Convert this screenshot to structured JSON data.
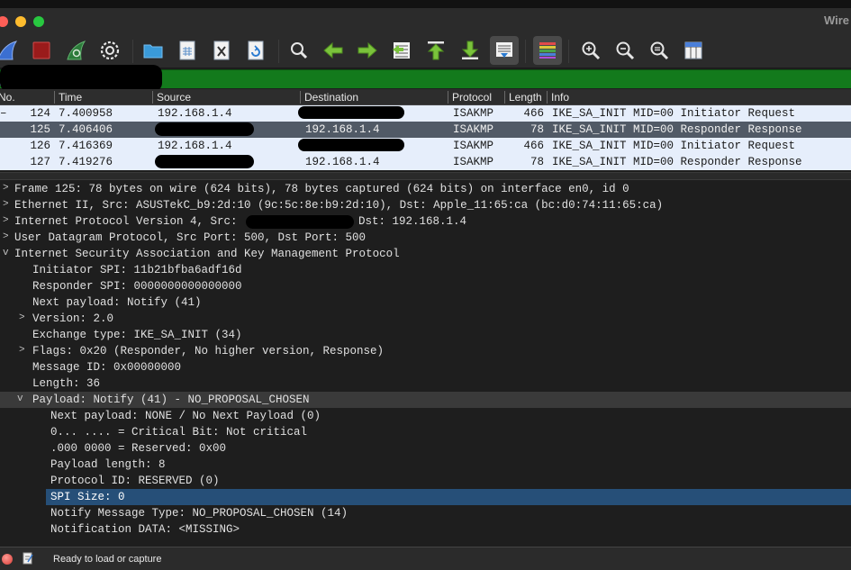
{
  "window": {
    "title": "Wire"
  },
  "colors": {
    "accent_green": "#137a1c",
    "selected_row": "#515a66",
    "selected_field": "#264f78"
  },
  "toolbar": {
    "icons": [
      "shark-fin-start-icon",
      "stop-icon",
      "restart-icon",
      "gear-options-icon",
      "folder-open-icon",
      "file-save-icon",
      "file-close-icon",
      "reload-icon",
      "find-icon",
      "arrow-back-icon",
      "arrow-forward-icon",
      "go-to-packet-icon",
      "go-first-icon",
      "go-last-icon",
      "autoscroll-icon",
      "colorize-icon",
      "zoom-in-icon",
      "zoom-out-icon",
      "zoom-normal-icon",
      "resize-columns-icon"
    ]
  },
  "filter": {
    "value": "",
    "placeholder": ""
  },
  "packet_list": {
    "columns": [
      "No.",
      "Time",
      "Source",
      "Destination",
      "Protocol",
      "Length",
      "Info"
    ],
    "rows": [
      {
        "no": "124",
        "time": "7.400958",
        "source": "192.168.1.4",
        "destination": "",
        "protocol": "ISAKMP",
        "length": "466",
        "info": "IKE_SA_INIT MID=00 Initiator Request",
        "selected": false
      },
      {
        "no": "125",
        "time": "7.406406",
        "source": "",
        "destination": "192.168.1.4",
        "protocol": "ISAKMP",
        "length": "78",
        "info": "IKE_SA_INIT MID=00 Responder Response",
        "selected": true
      },
      {
        "no": "126",
        "time": "7.416369",
        "source": "192.168.1.4",
        "destination": "",
        "protocol": "ISAKMP",
        "length": "466",
        "info": "IKE_SA_INIT MID=00 Initiator Request",
        "selected": false
      },
      {
        "no": "127",
        "time": "7.419276",
        "source": "",
        "destination": "192.168.1.4",
        "protocol": "ISAKMP",
        "length": "78",
        "info": "IKE_SA_INIT MID=00 Responder Response",
        "selected": false
      }
    ]
  },
  "details": {
    "lines": [
      {
        "text": "Frame 125: 78 bytes on wire (624 bits), 78 bytes captured (624 bits) on interface en0, id 0",
        "toggle": ">"
      },
      {
        "text": "Ethernet II, Src: ASUSTekC_b9:2d:10 (9c:5c:8e:b9:2d:10), Dst: Apple_11:65:ca (bc:d0:74:11:65:ca)",
        "toggle": ">"
      },
      {
        "text": "Internet Protocol Version 4, Src:",
        "toggle": ">",
        "suffix": "Dst: 192.168.1.4"
      },
      {
        "text": "User Datagram Protocol, Src Port: 500, Dst Port: 500",
        "toggle": ">"
      },
      {
        "text": "Internet Security Association and Key Management Protocol",
        "toggle": "v"
      },
      {
        "text": "Initiator SPI: 11b21bfba6adf16d",
        "toggle": ""
      },
      {
        "text": "Responder SPI: 0000000000000000",
        "toggle": ""
      },
      {
        "text": "Next payload: Notify (41)",
        "toggle": ""
      },
      {
        "text": "Version: 2.0",
        "toggle": ">"
      },
      {
        "text": "Exchange type: IKE_SA_INIT (34)",
        "toggle": ""
      },
      {
        "text": "Flags: 0x20 (Responder, No higher version, Response)",
        "toggle": ">"
      },
      {
        "text": "Message ID: 0x00000000",
        "toggle": ""
      },
      {
        "text": "Length: 36",
        "toggle": ""
      },
      {
        "text": "Payload: Notify (41) - NO_PROPOSAL_CHOSEN",
        "toggle": "v"
      },
      {
        "text": "Next payload: NONE / No Next Payload  (0)",
        "toggle": ""
      },
      {
        "text": "0... .... = Critical Bit: Not critical",
        "toggle": ""
      },
      {
        "text": ".000 0000 = Reserved: 0x00",
        "toggle": ""
      },
      {
        "text": "Payload length: 8",
        "toggle": ""
      },
      {
        "text": "Protocol ID: RESERVED (0)",
        "toggle": ""
      },
      {
        "text": "SPI Size: 0",
        "toggle": ""
      },
      {
        "text": "Notify Message Type: NO_PROPOSAL_CHOSEN (14)",
        "toggle": ""
      },
      {
        "text": "Notification DATA: <MISSING>",
        "toggle": ""
      }
    ]
  },
  "status": {
    "text": "Ready to load or capture"
  }
}
